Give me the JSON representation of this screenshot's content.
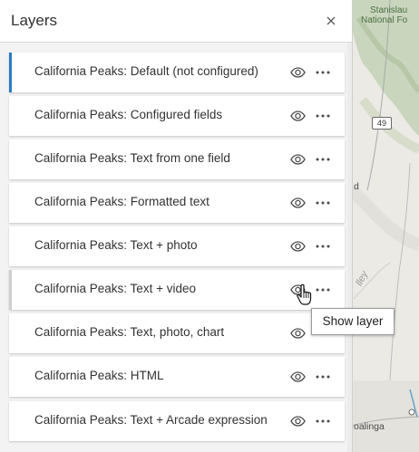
{
  "panel": {
    "title": "Layers",
    "close_icon": "close-icon"
  },
  "layers": [
    {
      "label": "California Peaks: Default (not configured)",
      "state": "selected"
    },
    {
      "label": "California Peaks: Configured fields",
      "state": "normal"
    },
    {
      "label": "California Peaks: Text from one field",
      "state": "normal"
    },
    {
      "label": "California Peaks: Formatted text",
      "state": "normal"
    },
    {
      "label": "California Peaks: Text + photo",
      "state": "normal"
    },
    {
      "label": "California Peaks: Text + video",
      "state": "hovered"
    },
    {
      "label": "California Peaks: Text, photo, chart",
      "state": "normal"
    },
    {
      "label": "California Peaks: HTML",
      "state": "normal"
    },
    {
      "label": "California Peaks: Text + Arcade expression",
      "state": "normal"
    }
  ],
  "tooltip": {
    "text": "Show layer"
  },
  "map": {
    "park_label_line1": "Stanislau",
    "park_label_line2": "National Fo",
    "highway_number": "49",
    "place_fragment": "d",
    "valley_fragment": "lley",
    "town_label": "oalinga"
  },
  "colors": {
    "selected_accent": "#2b7bc0",
    "icon": "#4a4a4a"
  }
}
